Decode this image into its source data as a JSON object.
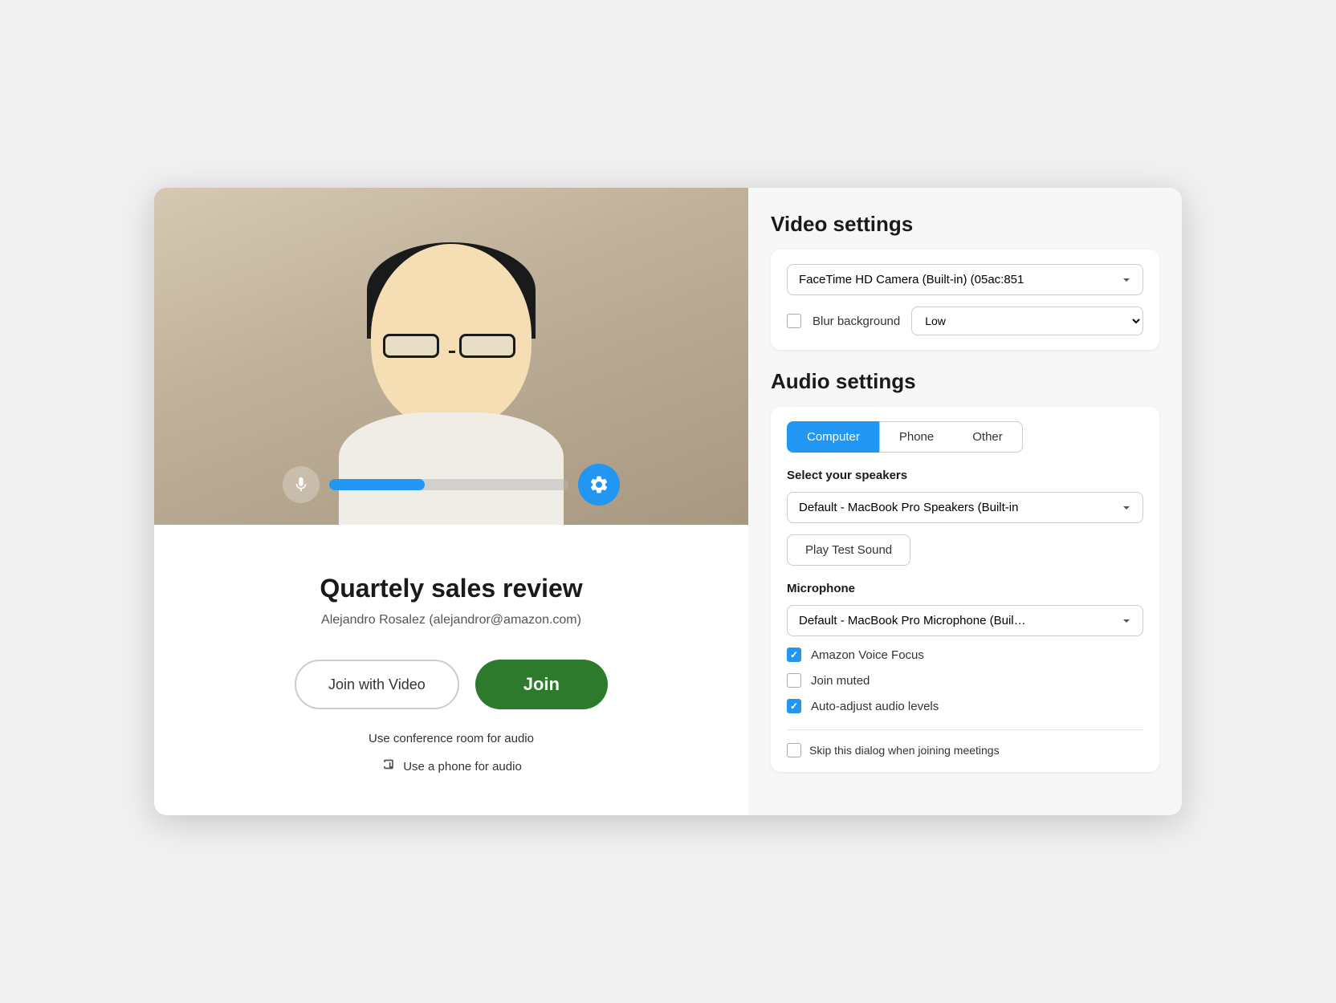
{
  "left": {
    "meeting_title": "Quartely sales review",
    "meeting_user": "Alejandro Rosalez (alejandror@amazon.com)",
    "btn_join_video_label": "Join with Video",
    "btn_join_label": "Join",
    "conference_audio_label": "Use conference room for audio",
    "phone_audio_label": "Use a phone for audio"
  },
  "right": {
    "video_settings_title": "Video settings",
    "camera_device": "FaceTime HD Camera (Built-in) (05ac:851",
    "blur_background_label": "Blur background",
    "blur_level": "Low",
    "audio_settings_title": "Audio settings",
    "tabs": [
      "Computer",
      "Phone",
      "Other"
    ],
    "active_tab": "Computer",
    "speakers_label": "Select your speakers",
    "speaker_device": "Default - MacBook Pro Speakers (Built-in",
    "play_test_sound_label": "Play Test Sound",
    "microphone_label": "Microphone",
    "microphone_device": "Default - MacBook Pro Microphone (Buil…",
    "amazon_voice_focus_label": "Amazon Voice Focus",
    "amazon_voice_focus_checked": true,
    "join_muted_label": "Join muted",
    "join_muted_checked": false,
    "auto_adjust_label": "Auto-adjust audio levels",
    "auto_adjust_checked": true,
    "skip_dialog_label": "Skip this dialog when joining meetings",
    "skip_dialog_checked": false
  },
  "colors": {
    "accent_blue": "#2196f3",
    "join_green": "#2d7a2d"
  }
}
